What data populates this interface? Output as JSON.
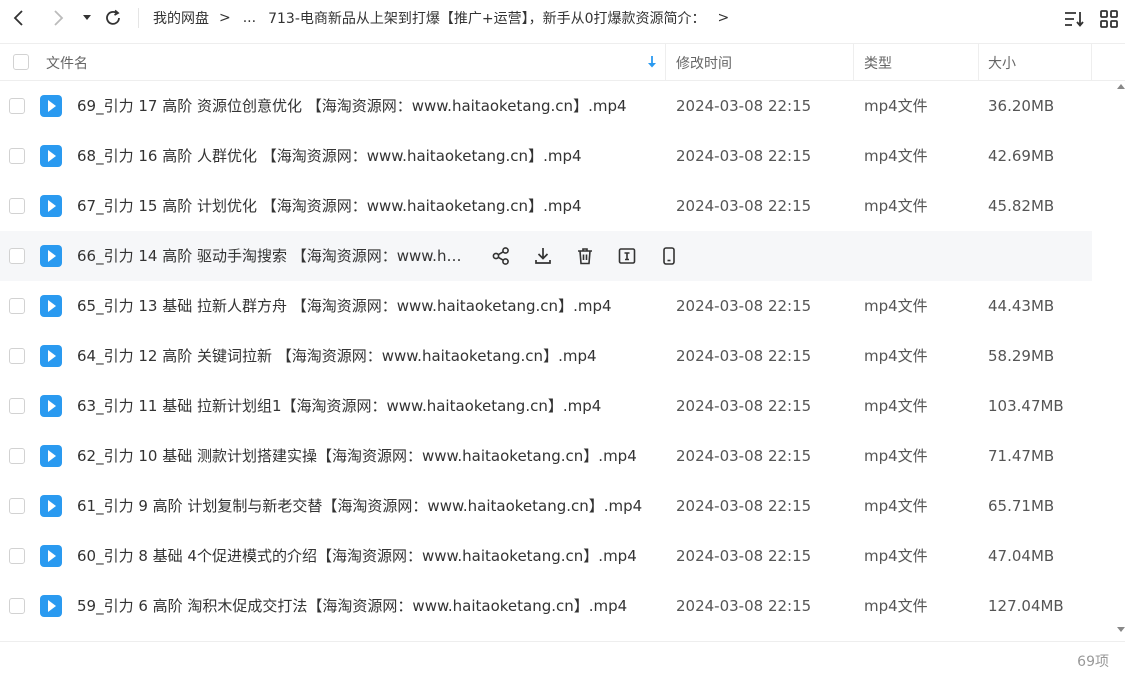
{
  "breadcrumb": {
    "root": "我的网盘",
    "ellipsis": "...",
    "current": "713-电商新品从上架到打爆【推广+运营】，新手从0打爆款资源简介："
  },
  "table": {
    "headers": {
      "name": "文件名",
      "time": "修改时间",
      "type": "类型",
      "size": "大小"
    }
  },
  "files": [
    {
      "name": "69_引力 17 高阶 资源位创意优化 【海淘资源网：www.haitaoketang.cn】.mp4",
      "time": "2024-03-08 22:15",
      "type": "mp4文件",
      "size": "36.20MB"
    },
    {
      "name": "68_引力 16 高阶 人群优化 【海淘资源网：www.haitaoketang.cn】.mp4",
      "time": "2024-03-08 22:15",
      "type": "mp4文件",
      "size": "42.69MB"
    },
    {
      "name": "67_引力 15 高阶 计划优化 【海淘资源网：www.haitaoketang.cn】.mp4",
      "time": "2024-03-08 22:15",
      "type": "mp4文件",
      "size": "45.82MB"
    },
    {
      "name": "66_引力 14 高阶 驱动手淘搜索 【海淘资源网：www.hai...",
      "time": "",
      "type": "",
      "size": ""
    },
    {
      "name": "65_引力 13 基础 拉新人群方舟 【海淘资源网：www.haitaoketang.cn】.mp4",
      "time": "2024-03-08 22:15",
      "type": "mp4文件",
      "size": "44.43MB"
    },
    {
      "name": "64_引力 12 高阶 关键词拉新 【海淘资源网：www.haitaoketang.cn】.mp4",
      "time": "2024-03-08 22:15",
      "type": "mp4文件",
      "size": "58.29MB"
    },
    {
      "name": "63_引力 11 基础 拉新计划组1【海淘资源网：www.haitaoketang.cn】.mp4",
      "time": "2024-03-08 22:15",
      "type": "mp4文件",
      "size": "103.47MB"
    },
    {
      "name": "62_引力 10 基础 测款计划搭建实操【海淘资源网：www.haitaoketang.cn】.mp4",
      "time": "2024-03-08 22:15",
      "type": "mp4文件",
      "size": "71.47MB"
    },
    {
      "name": "61_引力 9 高阶 计划复制与新老交替【海淘资源网：www.haitaoketang.cn】.mp4",
      "time": "2024-03-08 22:15",
      "type": "mp4文件",
      "size": "65.71MB"
    },
    {
      "name": "60_引力 8 基础 4个促进模式的介绍【海淘资源网：www.haitaoketang.cn】.mp4",
      "time": "2024-03-08 22:15",
      "type": "mp4文件",
      "size": "47.04MB"
    },
    {
      "name": "59_引力 6 高阶 淘积木促成交打法【海淘资源网：www.haitaoketang.cn】.mp4",
      "time": "2024-03-08 22:15",
      "type": "mp4文件",
      "size": "127.04MB"
    }
  ],
  "hover_row_actions": [
    "share-icon",
    "download-icon",
    "delete-icon",
    "rename-icon",
    "open-on-phone-icon"
  ],
  "footer": {
    "count": "69项"
  },
  "colors": {
    "accent": "#2a9af0",
    "hover_row": "#f6f7f9",
    "border": "#eeeeee"
  }
}
